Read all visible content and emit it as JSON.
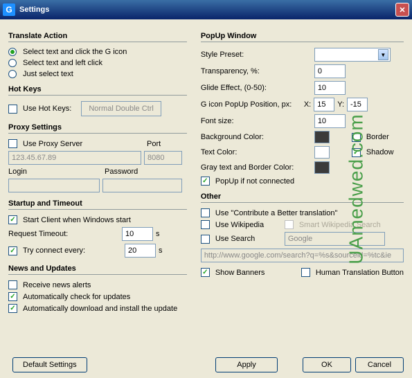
{
  "titlebar": {
    "title": "Settings",
    "icon_glyph": "G"
  },
  "left": {
    "translate_action": {
      "heading": "Translate Action",
      "opt1": "Select text and click the G icon",
      "opt2": "Select text and left click",
      "opt3": "Just select text",
      "selected": 0
    },
    "hotkeys": {
      "heading": "Hot Keys",
      "label": "Use Hot Keys:",
      "button": "Normal Double Ctrl"
    },
    "proxy": {
      "heading": "Proxy Settings",
      "use_label": "Use Proxy Server",
      "port_label": "Port",
      "server_value": "123.45.67.89",
      "port_value": "8080",
      "login_label": "Login",
      "password_label": "Password"
    },
    "startup": {
      "heading": "Startup and Timeout",
      "start_label": "Start Client when Windows start",
      "timeout_label": "Request Timeout:",
      "timeout_value": "10",
      "seconds": "s",
      "tryconn_label": "Try connect every:",
      "tryconn_value": "20"
    },
    "news": {
      "heading": "News and Updates",
      "receive": "Receive news alerts",
      "autocheck": "Automatically check for updates",
      "autodl": "Automatically download and install the update"
    }
  },
  "right": {
    "popup": {
      "heading": "PopUp Window",
      "style_label": "Style Preset:",
      "trans_label": "Transparency, %:",
      "trans_value": "0",
      "glide_label": "Glide Effect, (0-50):",
      "glide_value": "10",
      "pos_label": "G icon PopUp Position, px:",
      "pos_x_label": "X:",
      "pos_x_value": "15",
      "pos_y_label": "Y:",
      "pos_y_value": "-15",
      "font_label": "Font size:",
      "font_value": "10",
      "bg_label": "Background Color:",
      "bg_value": "#3b3b3b",
      "text_label": "Text Color:",
      "text_value": "#ffffff",
      "gray_label": "Gray text and Border Color:",
      "gray_value": "#3b3b3b",
      "border_label": "Border",
      "shadow_label": "Shadow",
      "ifnot_label": "PopUp if not connected"
    },
    "other": {
      "heading": "Other",
      "contribute": "Use \"Contribute a Better translation\"",
      "wikipedia": "Use Wikipedia",
      "smart_wiki": "Smart Wikipedia Search",
      "usesearch": "Use Search",
      "search_value": "Google",
      "url_value": "http://www.google.com/search?q=%s&sourceid=%tc&ie",
      "banners": "Show Banners",
      "human": "Human Translation Button"
    }
  },
  "footer": {
    "defaults": "Default Settings",
    "apply": "Apply",
    "ok": "OK",
    "cancel": "Cancel"
  },
  "watermark": "UAmedwed.com"
}
